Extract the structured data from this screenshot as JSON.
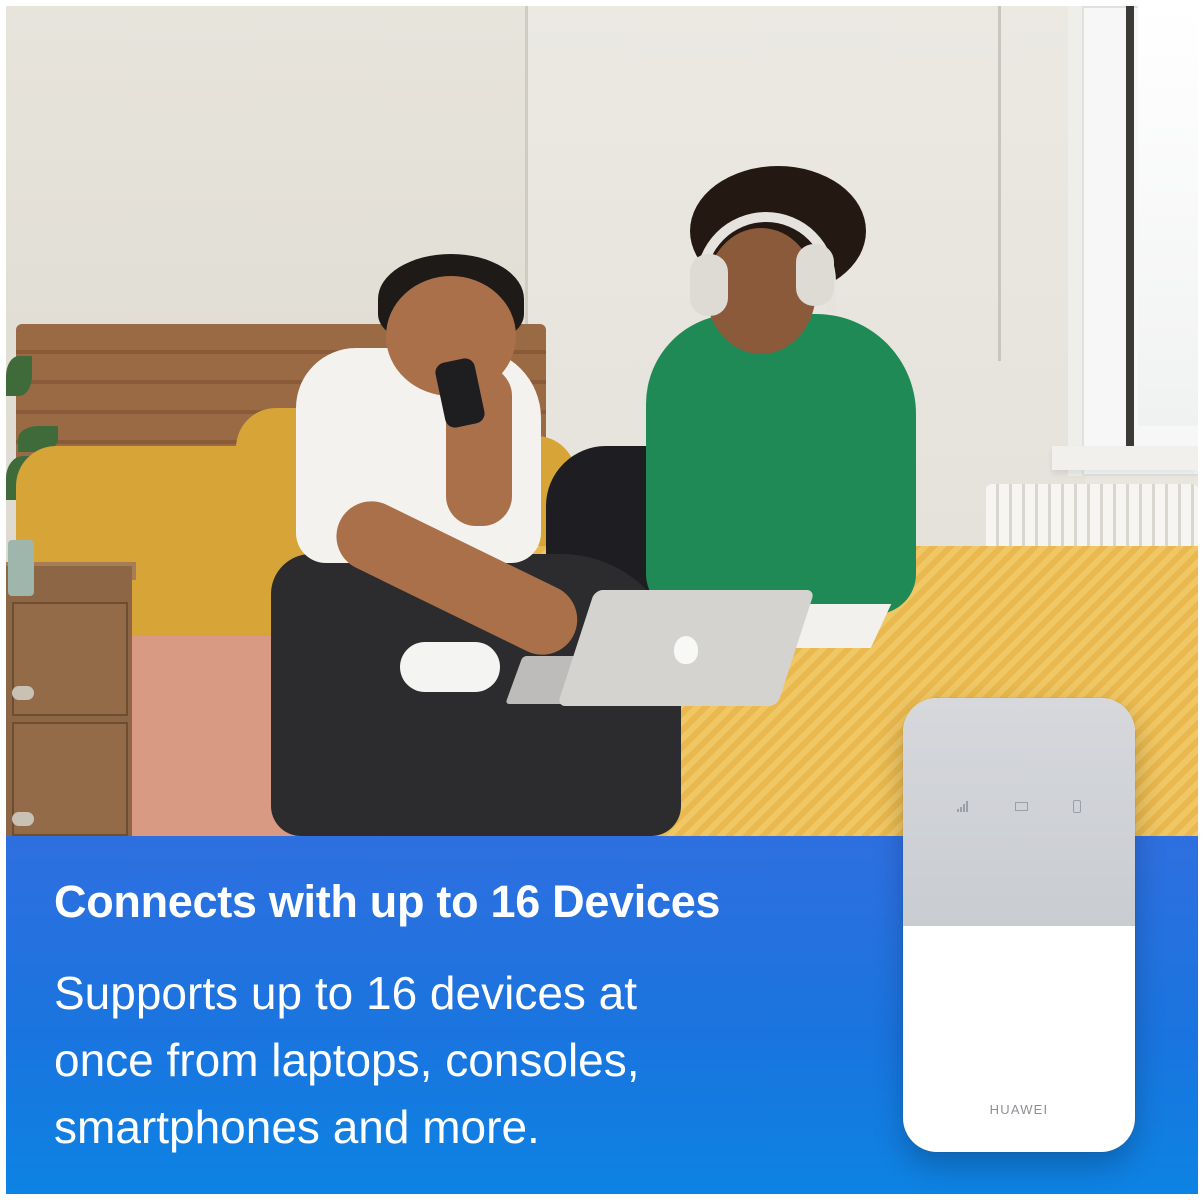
{
  "banner": {
    "headline": "Connects with up to 16 Devices",
    "body_lines": [
      "Supports up to 16 devices at",
      "once from laptops, consoles,",
      "smartphones and more."
    ],
    "background_color": "#1a74df",
    "text_color": "#ffffff"
  },
  "device": {
    "brand": "HUAWEI",
    "indicator_icons": [
      "signal-icon",
      "mail-icon",
      "battery-icon"
    ]
  }
}
